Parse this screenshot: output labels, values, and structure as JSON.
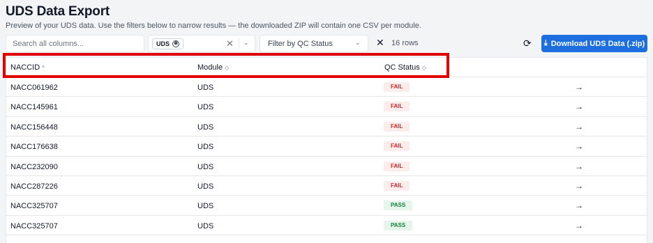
{
  "page": {
    "title": "UDS Data Export",
    "subtitle": "Preview of your UDS data. Use the filters below to narrow results — the downloaded ZIP will contain one CSV per module."
  },
  "toolbar": {
    "search_placeholder": "Search all columns...",
    "module_chip": "UDS",
    "chip_remove_glyph": "⊗",
    "clear_glyph": "✕",
    "chevron_glyph": "⌄",
    "qc_placeholder": "Filter by QC Status",
    "reset_glyph": "✕",
    "row_count": "16 rows",
    "refresh_glyph": "⟳",
    "download_icon": "⤓",
    "download_label": "Download UDS Data (.zip)"
  },
  "table": {
    "columns": [
      {
        "label": "NACCID",
        "sort": "^"
      },
      {
        "label": "Module",
        "sort": "◇"
      },
      {
        "label": "QC Status",
        "sort": "◇"
      }
    ],
    "rows": [
      {
        "naccid": "NACC061962",
        "module": "UDS",
        "qc": "FAIL",
        "status": "fail",
        "arrow": "→"
      },
      {
        "naccid": "NACC145961",
        "module": "UDS",
        "qc": "FAIL",
        "status": "fail",
        "arrow": "→"
      },
      {
        "naccid": "NACC156448",
        "module": "UDS",
        "qc": "FAIL",
        "status": "fail",
        "arrow": "→"
      },
      {
        "naccid": "NACC176638",
        "module": "UDS",
        "qc": "FAIL",
        "status": "fail",
        "arrow": "→"
      },
      {
        "naccid": "NACC232090",
        "module": "UDS",
        "qc": "FAIL",
        "status": "fail",
        "arrow": "→"
      },
      {
        "naccid": "NACC287226",
        "module": "UDS",
        "qc": "FAIL",
        "status": "fail",
        "arrow": "→"
      },
      {
        "naccid": "NACC325707",
        "module": "UDS",
        "qc": "PASS",
        "status": "pass",
        "arrow": "→"
      },
      {
        "naccid": "NACC325707",
        "module": "UDS",
        "qc": "PASS",
        "status": "pass",
        "arrow": "→"
      }
    ]
  },
  "colors": {
    "accent": "#1d6fe0",
    "fail_text": "#dc2626",
    "fail_bg": "#fdecec",
    "pass_text": "#15803d",
    "pass_bg": "#e6f6ec",
    "highlight": "#e00000"
  }
}
